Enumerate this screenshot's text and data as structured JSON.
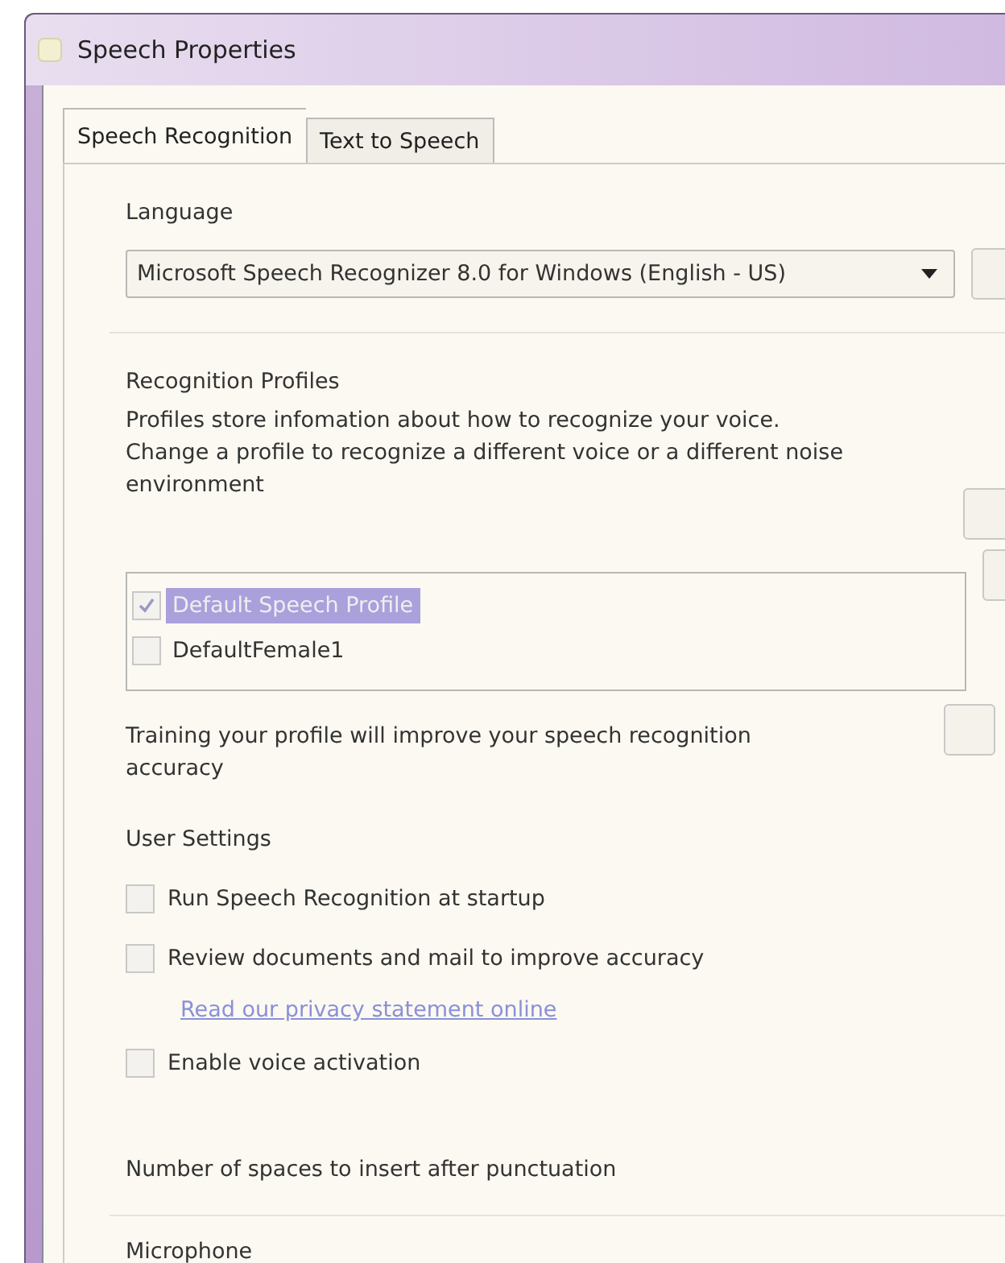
{
  "window": {
    "title": "Speech Properties"
  },
  "tabs": [
    {
      "label": "Speech Recognition",
      "selected": true
    },
    {
      "label": "Text to Speech",
      "selected": false
    }
  ],
  "language": {
    "label": "Language",
    "value": "Microsoft Speech Recognizer 8.0 for Windows (English - US)"
  },
  "profiles": {
    "heading": "Recognition Profiles",
    "description": [
      "Profiles store infomation about how to recognize your voice.",
      "Change a profile to recognize a different voice or a different noise environment"
    ],
    "items": [
      {
        "label": "Default Speech Profile",
        "checked": true,
        "selected": true
      },
      {
        "label": "DefaultFemale1",
        "checked": false,
        "selected": false
      }
    ]
  },
  "training": {
    "text": "Training your profile will improve your speech recognition accuracy"
  },
  "user_settings": {
    "heading": "User Settings",
    "items": [
      {
        "kind": "checkbox",
        "label": "Run Speech Recognition at startup",
        "checked": false
      },
      {
        "kind": "checkbox",
        "label": "Review documents and mail to improve accuracy",
        "checked": false
      },
      {
        "kind": "link",
        "label": "Read our privacy statement online"
      },
      {
        "kind": "checkbox",
        "label": "Enable voice activation",
        "checked": false
      }
    ],
    "spaces_label": "Number of spaces to insert after punctuation"
  },
  "microphone": {
    "heading": "Microphone"
  }
}
